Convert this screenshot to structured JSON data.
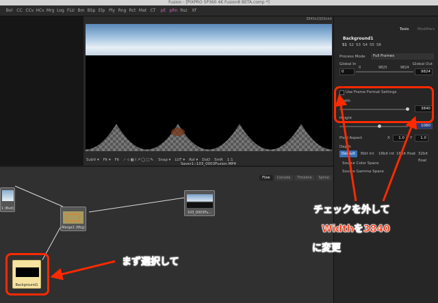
{
  "app": {
    "title": "Fusion - [PIXPRO SP360 4K Fusion8 BETA.comp *]"
  },
  "toolbar": {
    "tools": [
      "Bol",
      "CC",
      "CCv",
      "HCv",
      "Mrg",
      "Log",
      "FLU",
      "Bm",
      "BSp",
      "Elp",
      "Ply",
      "Rng",
      "Rct",
      "Mat",
      "CT",
      "pE",
      "pRn",
      "Rsz",
      "Xf"
    ]
  },
  "viewer": {
    "resolution": "3840x1920xint",
    "controls": [
      "SubV ▾",
      "Fit ▾",
      "Fit",
      "LUT ▾",
      "RoI ▾",
      "DoD",
      "SmR",
      "1:1",
      "Snap ▾"
    ],
    "saver_label": "Saver1::103_0003Fusion.MP4"
  },
  "flow": {
    "tabs": [
      "Flow",
      "Console",
      "Timeline",
      "Spline"
    ],
    "nodes": {
      "merge": "Merge1 (Mrg)",
      "saver": "103_0003Fu...",
      "background": "Background1",
      "left_node": "1 (Bvd)"
    }
  },
  "inspector": {
    "tabs": [
      "Tools",
      "Modifiers"
    ],
    "tool_name": "Background1",
    "scenes": [
      "S1",
      "S2",
      "S3",
      "S4",
      "S5",
      "S6"
    ],
    "process_mode_label": "Process Mode",
    "process_mode_value": "Full Frames",
    "global_in_label": "Global In",
    "global_out_label": "Global Out",
    "global_in_value": "0",
    "global_mid_0": "0",
    "global_mid_9825": "9825",
    "global_mid_9824": "9824",
    "global_out_value": "9824",
    "use_frame_format": "Use Frame Format Settings",
    "width_label": "Width",
    "width_value": "3840",
    "height_label": "Height",
    "height_value": "1080",
    "pixel_aspect_label": "Pixel Aspect",
    "pa_x_label": "X",
    "pa_x_value": "1.0",
    "pa_y_label": "Y",
    "pa_y_value": "1.0",
    "depth_label": "Depth",
    "depth_options": [
      "Default",
      "8bit int",
      "16bit int",
      "16bit float",
      "32bit float"
    ],
    "source_color_space": "Source Color Space",
    "source_gamma_space": "Source Gamma Space"
  },
  "annotations": {
    "uncheck_line1": "チェックを外して",
    "uncheck_line2": "Widthを3840",
    "uncheck_line3": "に変更",
    "select_first": "まず選択して"
  },
  "colors": {
    "annotation_red": "#ff2a00",
    "background_node": "#f6e3a0",
    "accent_pink": "#c86bb8"
  }
}
